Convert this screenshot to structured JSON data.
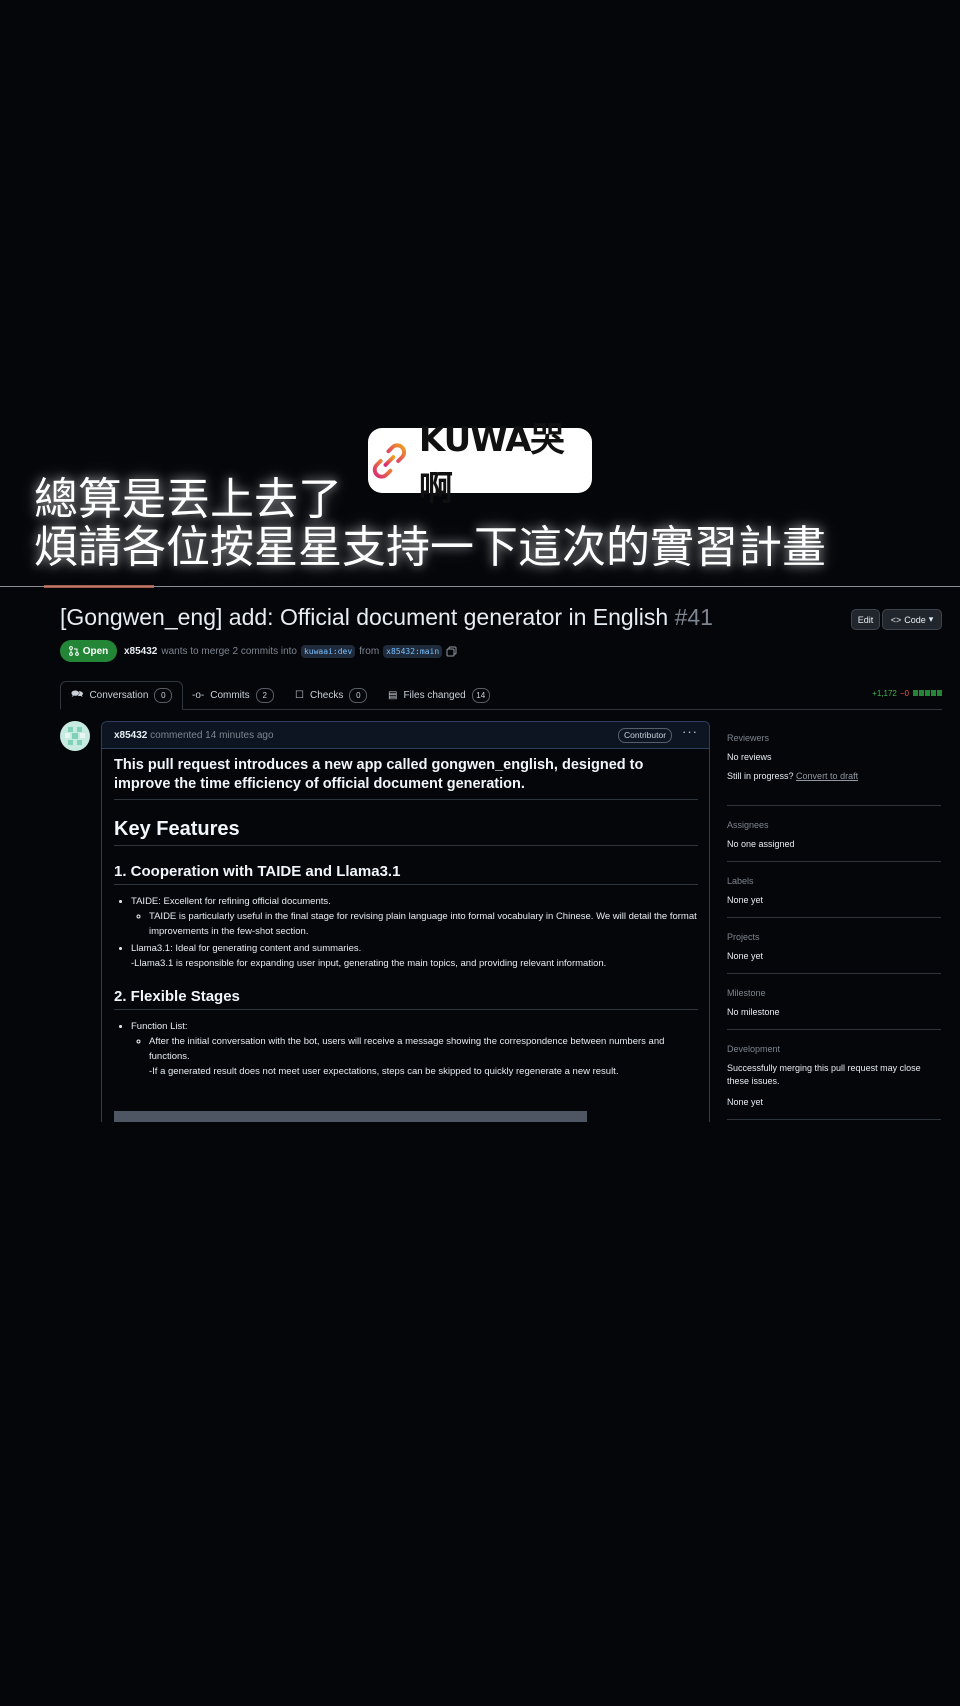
{
  "overlay": {
    "channel_name": "KUWA哭啊",
    "subtitle_line1": "總算是丟上去了",
    "subtitle_line2": "煩請各位按星星支持一下這次的實習計畫"
  },
  "pr": {
    "title": "[Gongwen_eng] add: Official document generator in English",
    "number": "#41",
    "state": "Open",
    "author": "x85432",
    "merge_text": "wants to merge 2 commits into",
    "base_branch": "kuwaai:dev",
    "from_text": "from",
    "head_branch": "x85432:main",
    "edit_label": "Edit",
    "code_label": "Code"
  },
  "tabs": [
    {
      "label": "Conversation",
      "count": "0"
    },
    {
      "label": "Commits",
      "count": "2"
    },
    {
      "label": "Checks",
      "count": "0"
    },
    {
      "label": "Files changed",
      "count": "14"
    }
  ],
  "diffstat": {
    "additions": "+1,172",
    "deletions": "−0"
  },
  "comment": {
    "author": "x85432",
    "action": "commented 14 minutes ago",
    "badge": "Contributor",
    "intro": "This pull request introduces a new app called gongwen_english, designed to improve the time efficiency of official document generation.",
    "heading": "Key Features",
    "section1_title": "1. Cooperation with TAIDE and Llama3.1",
    "s1_item1": "TAIDE: Excellent for refining official documents.",
    "s1_item1_sub": "TAIDE is particularly useful in the final stage for revising plain language into formal vocabulary in Chinese. We will detail the format improvements in the few-shot section.",
    "s1_item2": "Llama3.1: Ideal for generating content and summaries.",
    "s1_item2_sub": "-Llama3.1 is responsible for expanding user input, generating the main topics, and providing relevant information.",
    "section2_title": "2. Flexible Stages",
    "s2_item1": "Function List:",
    "s2_item1_sub": "After the initial conversation with the bot, users will receive a message showing the correspondence between numbers and functions.",
    "s2_item1_sub2": "-If a generated result does not meet user expectations, steps can be skipped to quickly regenerate a new result."
  },
  "sidebar": {
    "reviewers_h": "Reviewers",
    "reviewers_v": "No reviews",
    "progress_q": "Still in progress?",
    "progress_link": "Convert to draft",
    "assignees_h": "Assignees",
    "assignees_v": "No one assigned",
    "labels_h": "Labels",
    "labels_v": "None yet",
    "projects_h": "Projects",
    "projects_v": "None yet",
    "milestone_h": "Milestone",
    "milestone_v": "No milestone",
    "development_h": "Development",
    "development_note": "Successfully merging this pull request may close these issues.",
    "development_v": "None yet"
  }
}
